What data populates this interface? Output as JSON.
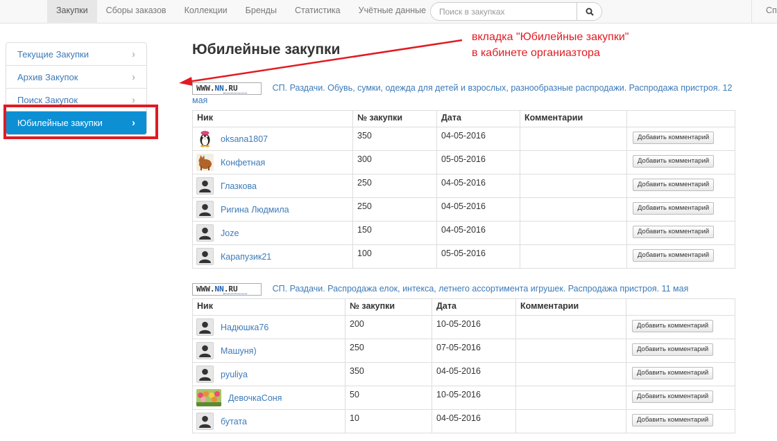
{
  "nav": {
    "items": [
      "Закупки",
      "Сборы заказов",
      "Коллекции",
      "Бренды",
      "Статистика",
      "Учётные данные"
    ],
    "active_index": 0,
    "search_placeholder": "Поиск в закупках",
    "right_label": "Спр"
  },
  "sidebar": {
    "items": [
      {
        "label": "Текущие Закупки"
      },
      {
        "label": "Архив Закупок"
      },
      {
        "label": "Поиск Закупок"
      },
      {
        "label": "Юбилейные закупки"
      }
    ],
    "active_index": 3
  },
  "page_title": "Юбилейные закупки",
  "annotation": {
    "line1": "вкладка \"Юбилейные закупки\"",
    "line2": "в кабинете органиазтора",
    "color": "#e11b22"
  },
  "site_logo": {
    "prefix": "WWW.",
    "brand": "NN",
    "suffix": ".RU"
  },
  "table_headers": [
    "Ник",
    "№ закупки",
    "Дата",
    "Комментарии",
    ""
  ],
  "comment_button_label": "Добавить комментарий",
  "blocks": [
    {
      "title": "СП. Раздачи. Обувь, сумки, одежда для детей и взрослых, разнообразные распродажи. Распродажа пристроя. 12 мая",
      "rows": [
        {
          "nick": "oksana1807",
          "number": "350",
          "date": "04-05-2016",
          "comment": "",
          "avatar": "penguin-avatar"
        },
        {
          "nick": "Конфетная",
          "number": "300",
          "date": "05-05-2016",
          "comment": "",
          "avatar": "cat-avatar"
        },
        {
          "nick": "Глазкова",
          "number": "250",
          "date": "04-05-2016",
          "comment": "",
          "avatar": "default-avatar"
        },
        {
          "nick": "Ригина Людмила",
          "number": "250",
          "date": "04-05-2016",
          "comment": "",
          "avatar": "default-avatar"
        },
        {
          "nick": "Joze",
          "number": "150",
          "date": "04-05-2016",
          "comment": "",
          "avatar": "default-avatar"
        },
        {
          "nick": "Карапузик21",
          "number": "100",
          "date": "05-05-2016",
          "comment": "",
          "avatar": "default-avatar"
        }
      ]
    },
    {
      "title": "СП. Раздачи. Распродажа елок, интекса, летнего ассортимента игрушек. Распродажа пристроя. 11 мая",
      "rows": [
        {
          "nick": "Надюшка76",
          "number": "200",
          "date": "10-05-2016",
          "comment": "",
          "avatar": "default-avatar"
        },
        {
          "nick": "Машуня)",
          "number": "250",
          "date": "07-05-2016",
          "comment": "",
          "avatar": "default-avatar"
        },
        {
          "nick": "pyuliya",
          "number": "350",
          "date": "04-05-2016",
          "comment": "",
          "avatar": "default-avatar"
        },
        {
          "nick": "ДевочкаСоня",
          "number": "50",
          "date": "10-05-2016",
          "comment": "",
          "avatar": "flowers-avatar"
        },
        {
          "nick": "бутата",
          "number": "10",
          "date": "04-05-2016",
          "comment": "",
          "avatar": "default-avatar"
        }
      ]
    }
  ],
  "colors": {
    "accent": "#0d8fd3",
    "link": "#3d7ab8",
    "highlight": "#e11b22"
  }
}
